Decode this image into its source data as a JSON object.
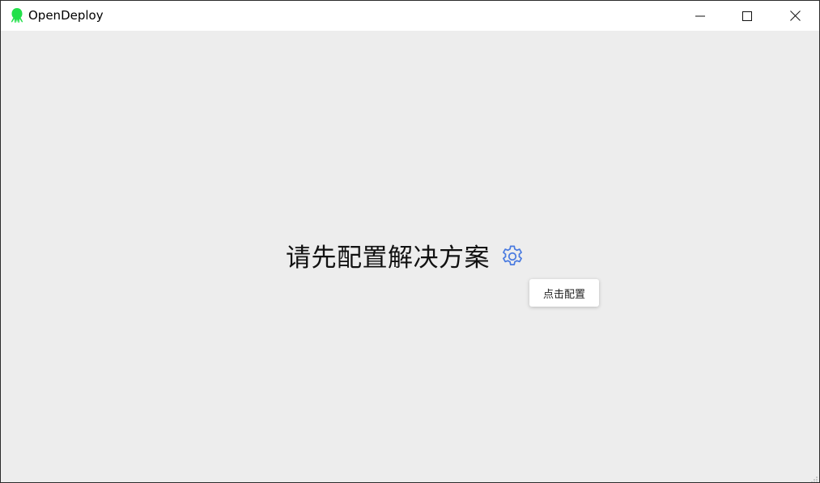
{
  "window": {
    "title": "OpenDeploy",
    "icon": "octopus-logo-icon",
    "controls": {
      "minimize": "minimize-icon",
      "maximize": "maximize-icon",
      "close": "close-icon"
    }
  },
  "main": {
    "message": "请先配置解决方案",
    "settings_icon": "gear-icon",
    "tooltip": "点击配置"
  },
  "colors": {
    "brand_green": "#22e04a",
    "accent_blue": "#4a7be0",
    "background": "#ededed",
    "titlebar": "#ffffff"
  }
}
